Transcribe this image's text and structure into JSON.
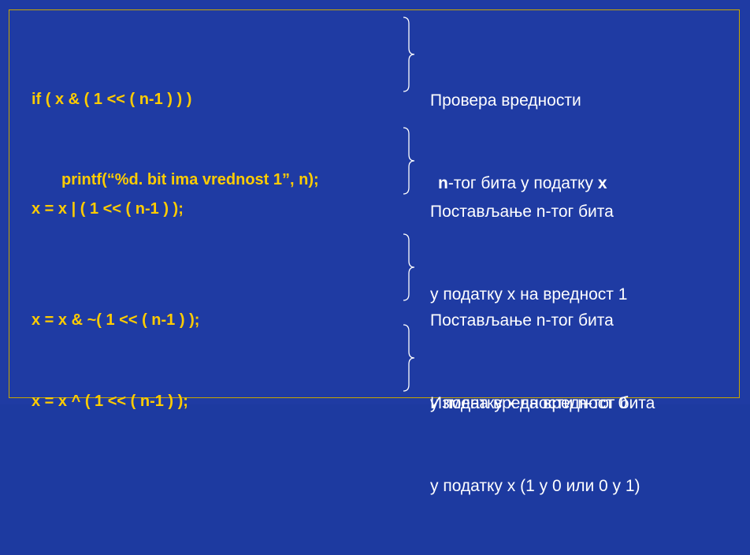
{
  "blocks": [
    {
      "code": [
        "if ( x & ( 1 << ( n-1 ) ) )",
        "printf(“%d. bit ima vrednost 1”, n);"
      ],
      "desc_line1": "Провера вредности",
      "desc_line2_bold1": "n",
      "desc_line2_mid": "-тог бита у податку ",
      "desc_line2_bold2": "x"
    },
    {
      "code": [
        "x = x | ( 1 << ( n-1 ) );"
      ],
      "desc": [
        "Постављање n-тог бита",
        "у податку x на вредност 1"
      ]
    },
    {
      "code": [
        "x = x & ~( 1 << ( n-1 ) );"
      ],
      "desc": [
        "Постављање n-тог бита",
        "у податку x на вредност 0"
      ]
    },
    {
      "code": [
        "x = x ^ ( 1 << ( n-1 ) );"
      ],
      "desc": [
        "Измена вредности n-тог бита",
        "у податку x (1 у 0 или 0 у 1)"
      ]
    }
  ],
  "colors": {
    "background": "#1f3ba3",
    "code_text": "#ffcc00",
    "desc_text": "#ffffff",
    "frame": "#c9a600"
  }
}
